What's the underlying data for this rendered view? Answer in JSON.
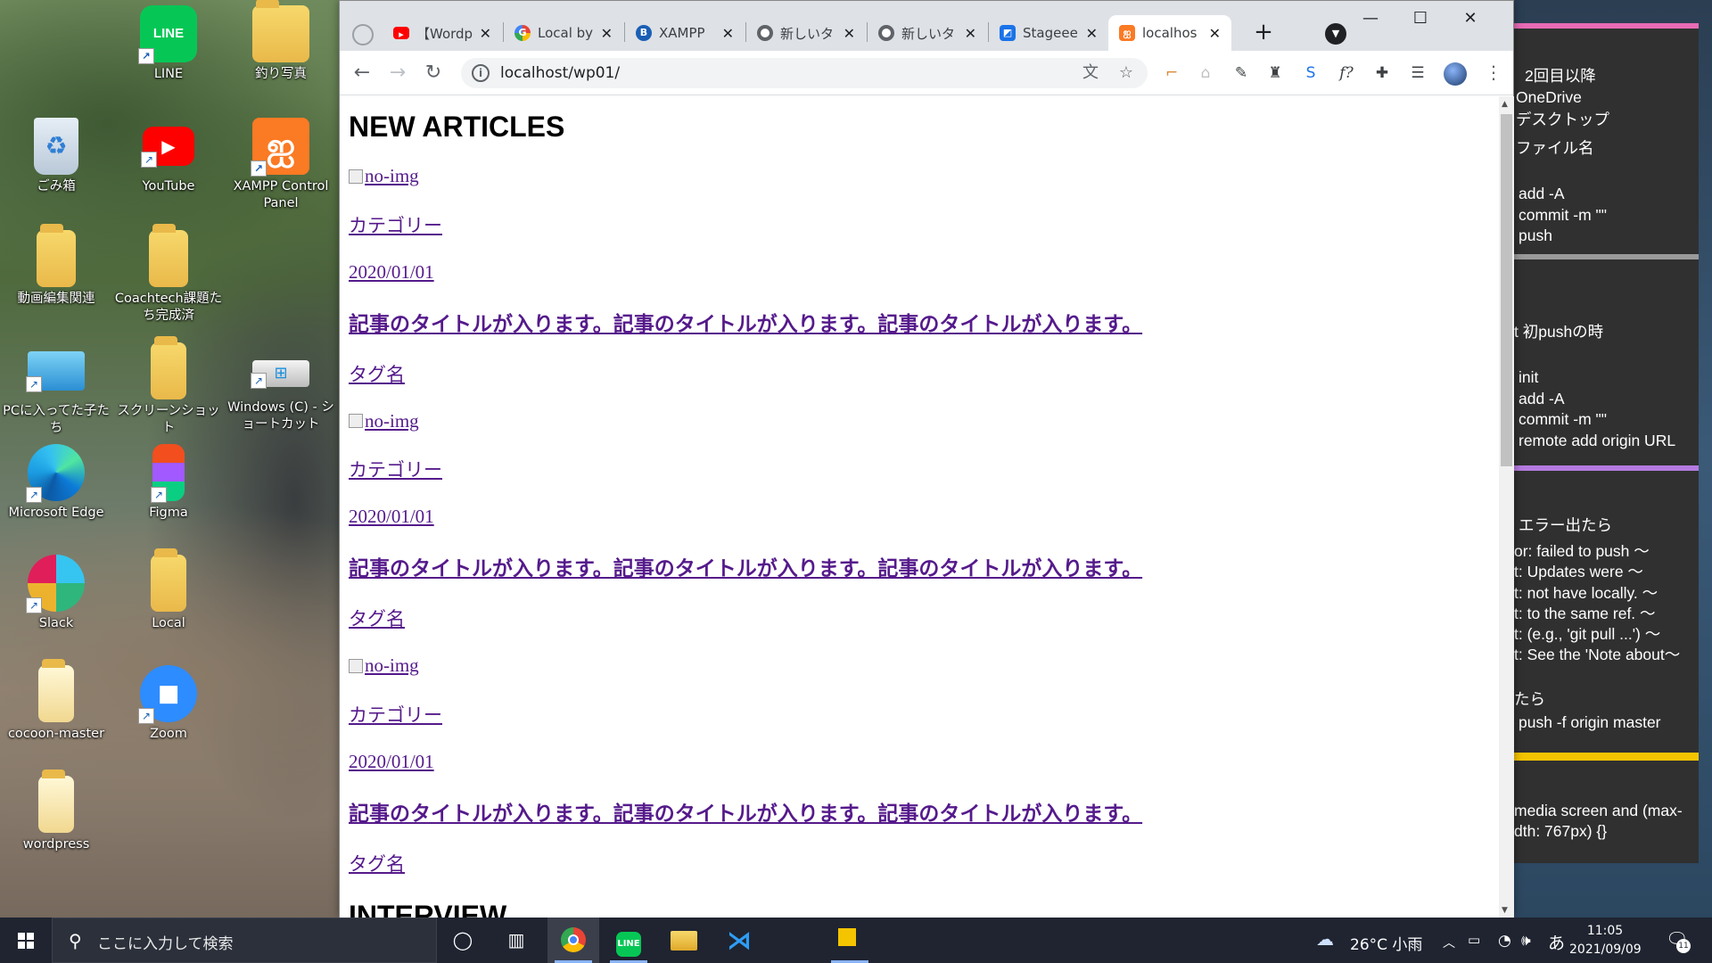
{
  "desktop": {
    "icons": [
      {
        "label": "LINE",
        "icon": "line-app-icon",
        "color": "#06c755"
      },
      {
        "label": "釣り写真",
        "icon": "folder-icon"
      },
      {
        "label": "ごみ箱",
        "icon": "recycle-bin-icon"
      },
      {
        "label": "YouTube",
        "icon": "youtube-icon",
        "color": "#ff0000"
      },
      {
        "label": "XAMPP Control Panel",
        "icon": "xampp-icon",
        "color": "#fb7a24"
      },
      {
        "label": "動画編集関連",
        "icon": "folder-icon"
      },
      {
        "label": "Coachtech課題たち完成済",
        "icon": "folder-icon"
      },
      {
        "label": "PCに入ってた子たち",
        "icon": "pc-folder-icon"
      },
      {
        "label": "スクリーンショット",
        "icon": "folder-icon"
      },
      {
        "label": "Windows (C) - ショートカット",
        "icon": "drive-icon"
      },
      {
        "label": "Microsoft Edge",
        "icon": "edge-icon",
        "color": "#0c7bd8"
      },
      {
        "label": "Figma",
        "icon": "figma-icon"
      },
      {
        "label": "Slack",
        "icon": "slack-icon"
      },
      {
        "label": "Local",
        "icon": "folder-icon"
      },
      {
        "label": "cocoon-master",
        "icon": "folder-icon"
      },
      {
        "label": "Zoom",
        "icon": "zoom-icon",
        "color": "#2d8cff"
      },
      {
        "label": "wordpress",
        "icon": "folder-icon"
      }
    ]
  },
  "browser": {
    "tabs": [
      {
        "label": "【Wordp",
        "icon": "youtube-icon",
        "color": "#ff0000"
      },
      {
        "label": "Local by",
        "icon": "google-icon",
        "color": "#4285f4"
      },
      {
        "label": "XAMPP",
        "icon": "b-icon",
        "color": "#1a5fb4"
      },
      {
        "label": "新しいタ",
        "icon": "chrome-icon",
        "color": "#5f6368"
      },
      {
        "label": "新しいタ",
        "icon": "chrome-icon",
        "color": "#5f6368"
      },
      {
        "label": "Stageee",
        "icon": "stageee-icon",
        "color": "#1a73e8"
      },
      {
        "label": "localhos",
        "icon": "xampp-icon",
        "color": "#fb7a24",
        "active": true
      }
    ],
    "url": "localhost/wp01/",
    "page": {
      "section_title": "NEW ARTICLES",
      "articles": [
        {
          "img_alt": "no-img",
          "category": "カテゴリー",
          "date": "2020/01/01",
          "title": "記事のタイトルが入ります。記事のタイトルが入ります。記事のタイトルが入ります。",
          "tag": "タグ名"
        },
        {
          "img_alt": "no-img",
          "category": "カテゴリー",
          "date": "2020/01/01",
          "title": "記事のタイトルが入ります。記事のタイトルが入ります。記事のタイトルが入ります。",
          "tag": "タグ名"
        },
        {
          "img_alt": "no-img",
          "category": "カテゴリー",
          "date": "2020/01/01",
          "title": "記事のタイトルが入ります。記事のタイトルが入ります。記事のタイトルが入ります。",
          "tag": "タグ名"
        }
      ],
      "next_section_title": "INTERVIEW"
    },
    "link_color": "#551a8b"
  },
  "notes": {
    "bar_colors": [
      "#e86bb5",
      "#9a9a9a",
      "#b57be0",
      "#f5c400"
    ],
    "lines": [
      "2回目以降",
      "OneDrive",
      "デスクトップ",
      "ファイル名",
      "add -A",
      "commit -m \"\"",
      "push",
      "t 初pushの時",
      "init",
      "add -A",
      "commit -m \"\"",
      "remote add origin URL",
      "エラー出たら",
      "or: failed to push ～",
      "t: Updates were ～",
      "t: not have locally. ～",
      "t: to the same ref. ～",
      "t: (e.g., 'git pull ...') ～",
      "t: See the 'Note about～",
      "たら",
      "push -f origin master",
      "media screen and (max-",
      "dth: 767px) {}"
    ]
  },
  "taskbar": {
    "search_placeholder": "ここに入力して検索",
    "weather": "26°C 小雨",
    "ime": "あ",
    "time": "11:05",
    "date": "2021/09/09",
    "notification_count": "11"
  }
}
